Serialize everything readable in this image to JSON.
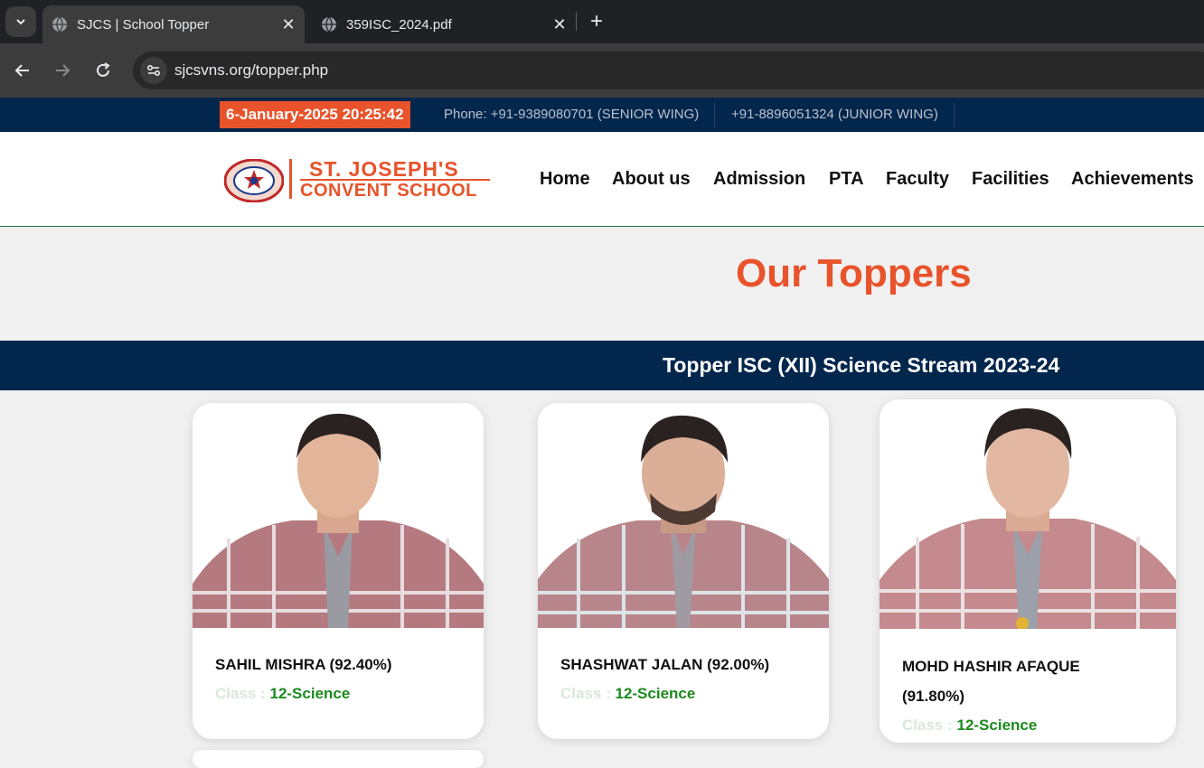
{
  "browser": {
    "tabs": [
      {
        "title": "SJCS | School Topper",
        "active": true
      },
      {
        "title": "359ISC_2024.pdf",
        "active": false
      }
    ],
    "url": "sjcsvns.org/topper.php"
  },
  "topbar": {
    "datetime": "6-January-2025 20:25:42",
    "phone_senior": "Phone: +91-9389080701 (SENIOR WING)",
    "phone_junior": "+91-8896051324 (JUNIOR WING)"
  },
  "logo": {
    "line1": "ST. JOSEPH'S",
    "line2": "CONVENT SCHOOL"
  },
  "nav": {
    "items": [
      "Home",
      "About us",
      "Admission",
      "PTA",
      "Faculty",
      "Facilities",
      "Achievements"
    ]
  },
  "page": {
    "heading": "Our Toppers",
    "stream_title": "Topper ISC (XII) Science Stream 2023-24"
  },
  "toppers": [
    {
      "name": "SAHIL MISHRA (92.40%)",
      "class_label": "Class : ",
      "class_value": "12-Science"
    },
    {
      "name": "SHASHWAT JALAN (92.00%)",
      "class_label": "Class : ",
      "class_value": "12-Science"
    },
    {
      "name_line1": "MOHD HASHIR AFAQUE",
      "name_line2": "(91.80%)",
      "class_label": "Class : ",
      "class_value": "12-Science"
    }
  ],
  "colors": {
    "accent_orange": "#e8532b",
    "navy": "#03264d",
    "class_green": "#1c8a1c"
  }
}
